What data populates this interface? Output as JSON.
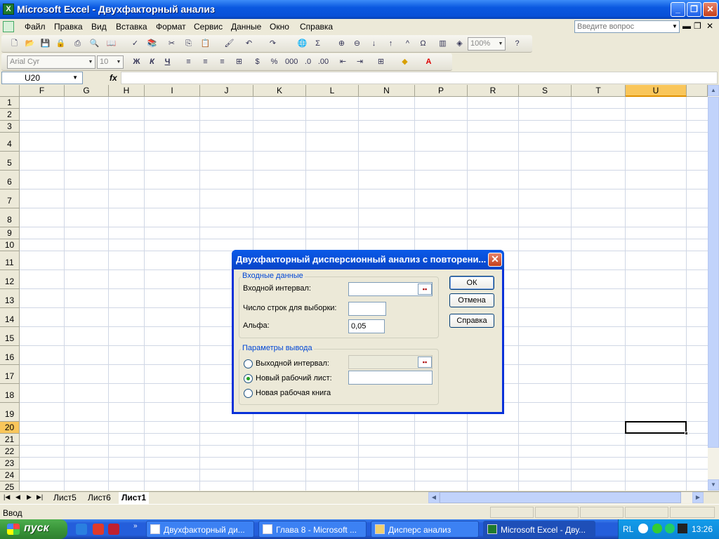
{
  "window": {
    "title": "Microsoft Excel - Двухфакторный анализ"
  },
  "menu": [
    "Файл",
    "Правка",
    "Вид",
    "Вставка",
    "Формат",
    "Сервис",
    "Данные",
    "Окно",
    "Справка"
  ],
  "help_box": {
    "placeholder": "Введите вопрос"
  },
  "standard_toolbar": {
    "zoom": "100%"
  },
  "formatting_toolbar": {
    "font": "Arial Cyr",
    "size": "10",
    "bold": "Ж",
    "italic": "К",
    "underline": "Ч"
  },
  "formula_bar": {
    "name_box": "U20",
    "fx": "fx",
    "value": ""
  },
  "columns": [
    "F",
    "G",
    "H",
    "I",
    "J",
    "K",
    "L",
    "N",
    "P",
    "R",
    "S",
    "T",
    "U"
  ],
  "rows": [
    "1",
    "2",
    "3",
    "4",
    "5",
    "6",
    "7",
    "8",
    "9",
    "10",
    "11",
    "12",
    "13",
    "14",
    "15",
    "16",
    "17",
    "18",
    "19",
    "20",
    "21",
    "22",
    "23",
    "24",
    "25"
  ],
  "active_cell": "U20",
  "sheet_tabs": [
    "Лист5",
    "Лист6",
    "Лист1"
  ],
  "active_sheet": "Лист1",
  "status": "Ввод",
  "dialog": {
    "title": "Двухфакторный дисперсионный анализ с повторени...",
    "input_group": "Входные данные",
    "input_range_label": "Входной интервал:",
    "input_range_value": "",
    "rows_per_sample_label": "Число строк для выборки:",
    "rows_per_sample_value": "",
    "alpha_label": "Альфа:",
    "alpha_value": "0,05",
    "output_group": "Параметры вывода",
    "output_range_label": "Выходной интервал:",
    "new_sheet_label": "Новый рабочий лист:",
    "new_book_label": "Новая рабочая книга",
    "selected_output": "Новый рабочий лист",
    "ok": "ОК",
    "cancel": "Отмена",
    "help": "Справка"
  },
  "taskbar": {
    "start": "пуск",
    "tasks": [
      "Двухфакторный ди...",
      "Глава 8 - Microsoft ...",
      "Дисперс анализ",
      "Microsoft Excel - Дву..."
    ],
    "language": "RL",
    "clock": "13:26"
  }
}
